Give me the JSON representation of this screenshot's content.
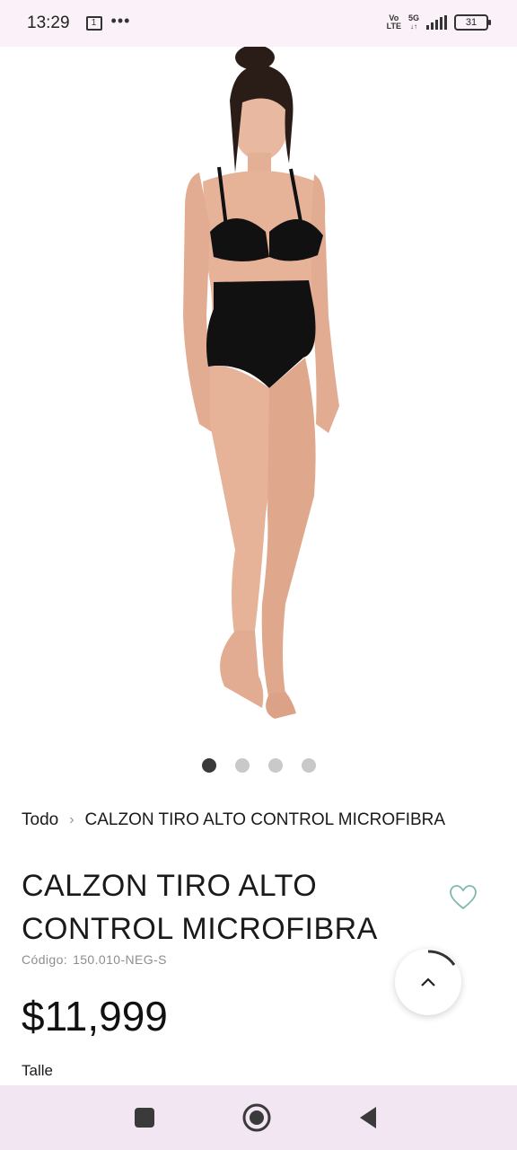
{
  "status_bar": {
    "time": "13:29",
    "calendar_day": "1",
    "overflow": "•••",
    "net_top": "Vo",
    "net_bottom": "LTE",
    "net2_top": "5G",
    "battery": "31"
  },
  "gallery": {
    "images_count": 4,
    "active_index": 0,
    "image_icon": "product-photo-model"
  },
  "breadcrumb": {
    "root": "Todo",
    "separator": "›",
    "current": "CALZON TIRO ALTO CONTROL MICROFIBRA"
  },
  "product": {
    "title": "CALZON TIRO ALTO CONTROL MICROFIBRA",
    "code_label": "Código:",
    "code_value": "150.010-NEG-S",
    "price": "$11,999",
    "size_label": "Talle"
  },
  "colors": {
    "accent": "#7fb8b0",
    "statusbar_bg": "#fbf1f8",
    "navbar_bg": "#f1e6f1"
  },
  "icons": {
    "favorite": "heart-outline-icon",
    "scroll_top": "chevron-up-icon",
    "nav_recents": "square-icon",
    "nav_home": "circle-icon",
    "nav_back": "triangle-back-icon"
  }
}
